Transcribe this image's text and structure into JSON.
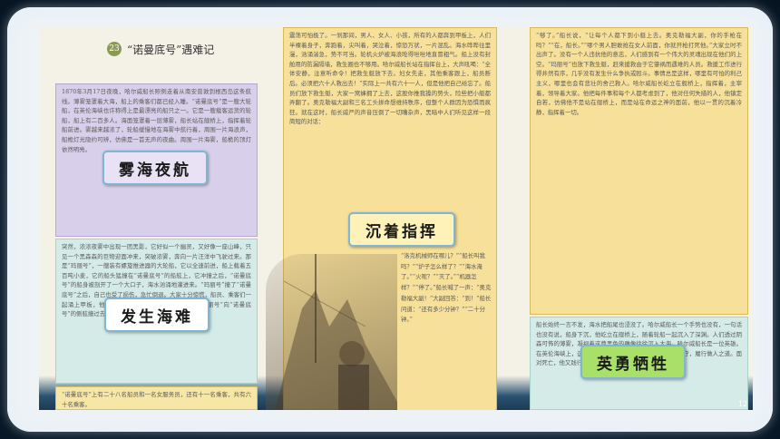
{
  "header": {
    "lesson_number": "23",
    "title": "“诺曼底号”遇难记"
  },
  "labels": {
    "foggy_voyage": "雾海夜航",
    "disaster": "发生海难",
    "calm_command": "沉着指挥",
    "heroic_sacrifice": "英勇牺牲"
  },
  "text": {
    "p1": "1870年3月17日夜晚，哈尔威船长照例走着从南安普敦到根西岛这条航线。薄雾笼罩着大海，船上的乘客们都已经入睡。“诺曼底号”是一艘大轮船，在英伦海峡也许称得上是最漂亮的船只之一。它是一艘载客运货的轮船，船上有二百多人。海面笼罩着一层薄雾，船长站在舰桥上，指挥着轮船前进。雾越来越浓了，轮船缓慢地在海雾中航行着，周围一片海浪声，船桅灯光隐约可辨，仿佛是一首无声的夜曲。周围一片海雾，船桅的顶灯依然明亮。",
    "p2": "突然，浓浓夜雾中出现一团黑影，它好似一个幽灵，又好像一座山峰，只见一个黑森森的巨物迎面冲来，突破浓雾，奔向一片汪洋中飞驶过来。那是“玛丽号”，一艘装有螺旋推进器的大轮船，它以全速前进，船上载着五百吨小麦，它的船头猛撞在“诺曼底号”的船舷上，它冲撞之后，“诺曼底号”的船身被剖开了一个大口子，海水汹涌地灌进来。“玛丽号”撞了“诺曼底号”之后，自己也受了损伤，急忙倒退。大家十分惊慌，船员、乘客们一起涌上甲板，他们奔跑着，一片混乱。全速前进的“玛丽号”向“诺曼底号”的侧舷撞过去，在它的船身上剖开一个大窟窿。",
    "p3": "“诺曼底号”上有二十八名船员和一名女服务员，还有十一名乘客，共有六十名乘客。",
    "m1": "震荡可怕极了。一刹那间，男人、女人、小孩，所有的人都奔到甲板上，人们半裸着身子，奔跑着，尖叫着，哭泣着，惊恐万状，一片混乱。海水哗哗往里漫，汹涌湍急，势不可当。轮机火炉被海浪呛得咝咝地直冒粗气。船上没有封舱用的防漏隔墙，救生圈也不够用。哈尔威船长站在指挥台上，大声吼喝：“全体安静，注意听命令！把救生艇放下去。妇女先走，其他乘客跟上，船员断后。必须把六十人救出去！”实际上一共有六十一人，但是他把自己给忘了。船员们放下救生艇，大家一窝蜂拥了上去，这股你推我搡的势头，险些把小艇都弄翻了。奥克勒福大副和三名工头拼命想维持秩序，但整个人群因为恐惧而疯狂。就在这时，船长威严的声音压倒了一切嘈杂声，黑暗中人们听见这样一段简短的对话：",
    "dialogue": "“洛克机械师在哪儿？”“船长叫我吗？”“炉子怎么样了？”“海水淹了。”“火呢？”“灭了。”“机器怎样？”“停了。”船长喊了一声：“奥克勒福大副！”大副回答：“到！”船长问道：“还有多少分钟？”“二十分钟。”",
    "r1": "“够了。”船长说，“让每个人都下到小艇上去。奥克勒福大副，你的手枪在吗？”“在，船长。”“哪个男人胆敢抢在女人前面，你就开枪打死他。”大家立时不出声了。没有一个人违抗他的意志，人们感到有一个伟大的灵魂出现在他们的上空。“玛丽号”也放下救生艇，赶来援救由于它肇祸而遇难的人员。救援工作进行得井然有序，几乎没有发生什么争执或殴斗。事情总是这样，哪里有可怕的利己主义，哪里也会有悲壮的舍己救人。哈尔威船长屹立在舰桥上，指挥着，主宰着，领导着大家。他把每件事和每个人都考虑到了，他对任何失措的人，他镇定自若，仿佛他不是站在舰桥上，而是站在命运之神的面前，他以一贯的沉着冷静，指挥着一切。",
    "r2": "船长始终一言不发，海水把船尾也浸没了。哈尔威船长一个手势也没有，一句话也没有说，船身下沉，他屹立在舰桥上，随着轮船一起沉入了深渊。人们透过阴森可怖的薄雾，凝视着这尊黑色的雕像徐徐沉入大海。哈尔威船长是一位英雄。在英伦海峡上，这样的人不多，他一生都要求自己忠于职守，履行做人之道。面对死亡，他又践行了一次英雄的壮举。"
  },
  "footer": {
    "page": "12"
  }
}
